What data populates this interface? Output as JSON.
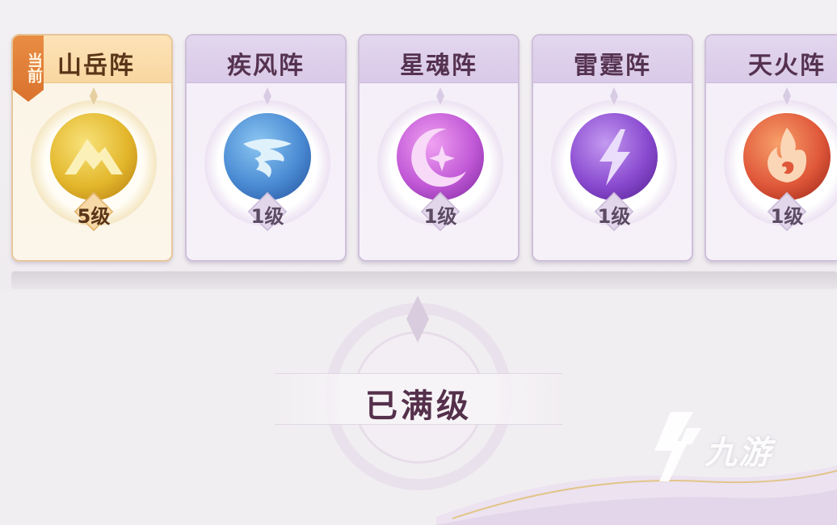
{
  "formations": [
    {
      "name": "山岳阵",
      "level": "5级",
      "current": true,
      "element": "mountain",
      "orb_color": "#e8c23a"
    },
    {
      "name": "疾风阵",
      "level": "1级",
      "current": false,
      "element": "wind",
      "orb_color": "#4c8fd6"
    },
    {
      "name": "星魂阵",
      "level": "1级",
      "current": false,
      "element": "star",
      "orb_color": "#c158d6"
    },
    {
      "name": "雷霆阵",
      "level": "1级",
      "current": false,
      "element": "thunder",
      "orb_color": "#8a4ad0"
    },
    {
      "name": "天火阵",
      "level": "1级",
      "current": false,
      "element": "fire",
      "orb_color": "#e0583a"
    }
  ],
  "current_badge": "当前",
  "status_text": "已满级",
  "watermark": {
    "text": "九游"
  },
  "colors": {
    "accent": "#e98d43",
    "title_text": "#55324f",
    "card_border": "#cfc0da"
  }
}
